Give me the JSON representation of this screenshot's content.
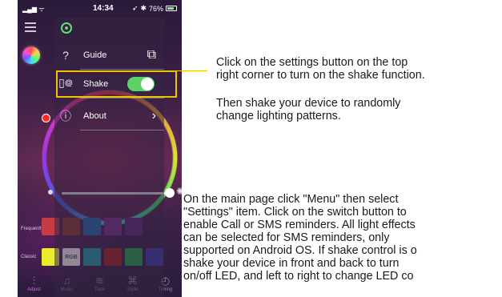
{
  "status_bar": {
    "time": "14:34",
    "battery": "76%"
  },
  "settings_menu": {
    "items": [
      {
        "label": "Guide",
        "icon": "question-icon",
        "control": "image-arrow"
      },
      {
        "label": "Shake",
        "icon": "phone-shake-icon",
        "control": "toggle",
        "toggle_on": true
      },
      {
        "label": "About",
        "icon": "info-icon",
        "control": "arrow"
      }
    ]
  },
  "swatches": {
    "frequently_label": "Frequently",
    "classic_label": "Classic",
    "frequently": [
      "#c73b46",
      "#8b3a2e",
      "#1f6aa8",
      "#7a2e8a",
      "#5a2c7a"
    ],
    "classic": [
      {
        "color": "#ecec2a",
        "text": ""
      },
      {
        "color": "#ffffff",
        "text": "RGB"
      },
      {
        "color": "#1ea0a8",
        "text": ""
      },
      {
        "color": "#a82020",
        "text": ""
      },
      {
        "color": "#1fa84c",
        "text": ""
      },
      {
        "color": "#3a3aa8",
        "text": ""
      }
    ]
  },
  "tabbar": {
    "tabs": [
      {
        "label": "Adjust",
        "icon": "sliders-icon",
        "active": true
      },
      {
        "label": "Music",
        "icon": "music-note-icon",
        "active": false
      },
      {
        "label": "Tape",
        "icon": "wave-icon",
        "active": false
      },
      {
        "label": "Style",
        "icon": "command-icon",
        "active": false
      },
      {
        "label": "Timing",
        "icon": "clock-icon",
        "active": false
      }
    ]
  },
  "colors": {
    "highlight": "#f2c200",
    "toggle_on": "#5bd166",
    "active_tab": "#c06ad8"
  },
  "instructions": {
    "shake_1": "Click on the settings button on the top\nright corner to turn on the shake function.",
    "shake_2": "Then shake your device to randomly\nchange lighting patterns.",
    "main": "On the main page click \"Menu\" then select\n\"Settings\" item. Click on the switch button to\nenable Call or SMS reminders. All light effects\ncan be selected for SMS reminders, only\nsupported on Android OS. If shake control is o\nshake your device in front and back to turn\non/off LED, and left to right to change LED co"
  }
}
